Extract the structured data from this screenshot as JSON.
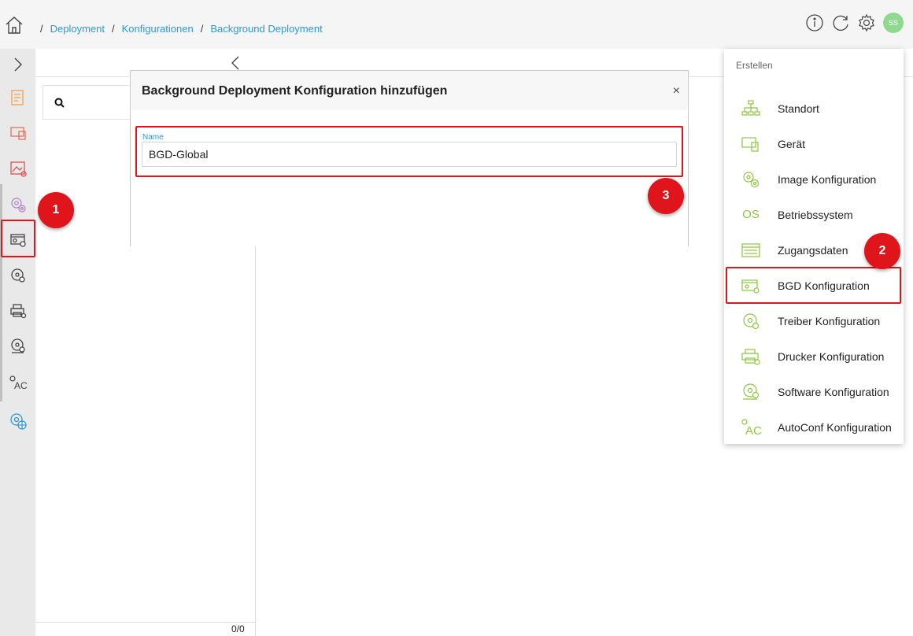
{
  "breadcrumb": {
    "items": [
      "Deployment",
      "Konfigurationen",
      "Background Deployment"
    ],
    "separator": "/"
  },
  "header": {
    "avatar_initials": "SS"
  },
  "icons": {
    "home": "home-icon",
    "info": "info-icon",
    "refresh": "refresh-icon",
    "settings": "gear-icon"
  },
  "sidebar": {
    "items": [
      {
        "icon": "chevron-right-icon"
      },
      {
        "icon": "document-icon"
      },
      {
        "icon": "device-icon"
      },
      {
        "icon": "image-icon"
      },
      {
        "icon": "image-config-gear-icon"
      },
      {
        "icon": "bgd-config-icon"
      },
      {
        "icon": "driver-disc-icon"
      },
      {
        "icon": "printer-icon"
      },
      {
        "icon": "software-disc-icon"
      },
      {
        "icon": "autoconf-icon"
      },
      {
        "icon": "globe-gear-icon"
      }
    ]
  },
  "list_panel": {
    "count": "0/0"
  },
  "dialog": {
    "title": "Background Deployment Konfiguration hinzufügen",
    "close_label": "×",
    "name_label": "Name",
    "name_value": "BGD-Global"
  },
  "menu": {
    "header": "Erstellen",
    "items": [
      {
        "label": "Standort",
        "icon": "sitemap-icon"
      },
      {
        "label": "Gerät",
        "icon": "device-icon"
      },
      {
        "label": "Image Konfiguration",
        "icon": "gear-cluster-icon"
      },
      {
        "label": "Betriebssystem",
        "icon": "os-icon",
        "icon_text": "OS"
      },
      {
        "label": "Zugangsdaten",
        "icon": "credentials-icon"
      },
      {
        "label": "BGD Konfiguration",
        "icon": "bgd-config-icon"
      },
      {
        "label": "Treiber Konfiguration",
        "icon": "driver-disc-icon"
      },
      {
        "label": "Drucker Konfiguration",
        "icon": "printer-icon"
      },
      {
        "label": "Software Konfiguration",
        "icon": "software-disc-icon"
      },
      {
        "label": "AutoConf Konfiguration",
        "icon": "autoconf-icon"
      }
    ]
  },
  "annotations": {
    "badges": [
      "1",
      "2",
      "3"
    ]
  },
  "colors": {
    "accent": "#2c99d8",
    "highlight": "#e0141b",
    "menu_icon": "#8dc63f",
    "avatar": "#8fd98f"
  }
}
